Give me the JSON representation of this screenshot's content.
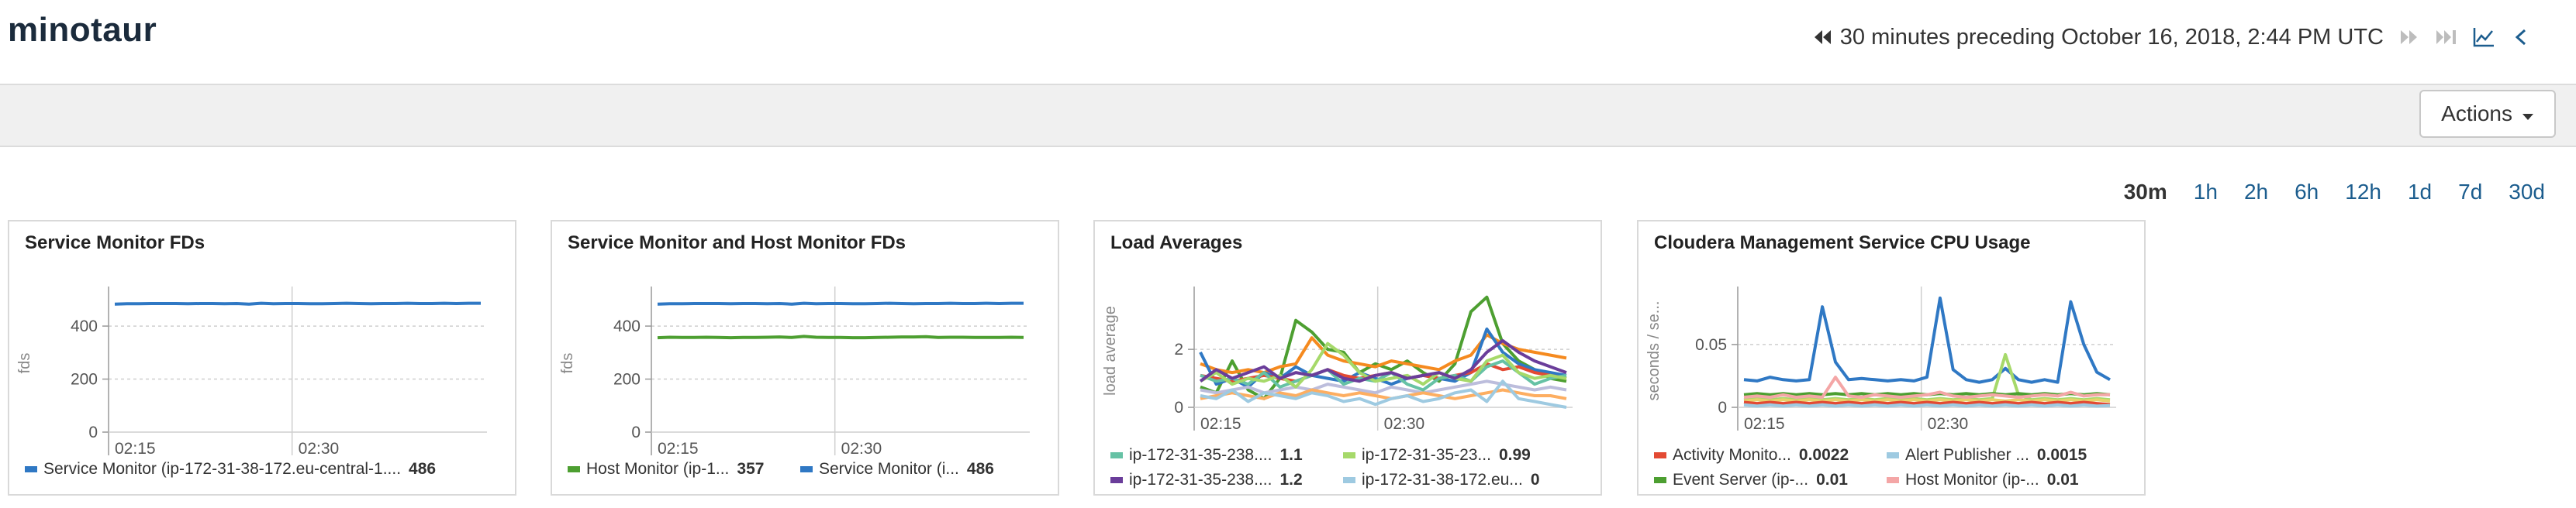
{
  "app": {
    "title": "minotaur"
  },
  "timebar": {
    "label": "30 minutes preceding October 16, 2018, 2:44 PM UTC",
    "icons": [
      "rewind-icon",
      "forward-icon",
      "skip-to-now-icon",
      "chart-icon",
      "collapse-icon"
    ]
  },
  "actions": {
    "label": "Actions",
    "icon": "caret-down-icon"
  },
  "ranges": [
    "30m",
    "1h",
    "2h",
    "6h",
    "12h",
    "1d",
    "7d",
    "30d"
  ],
  "active_range": "30m",
  "chart_data": [
    {
      "title": "Service Monitor FDs",
      "type": "line",
      "ylabel": "fds",
      "x_ticks": [
        "02:15",
        "02:30"
      ],
      "y_ticks": [
        "0",
        "200",
        "400"
      ],
      "ylim": [
        0,
        520
      ],
      "series": [
        {
          "name": "Service Monitor (ip-172-31-38-172.eu-central-1....",
          "color": "#2f78c4",
          "last": "486",
          "values": [
            483,
            484,
            484,
            485,
            485,
            485,
            484,
            485,
            485,
            484,
            485,
            483,
            486,
            484,
            485,
            485,
            484,
            484,
            485,
            486,
            485,
            484,
            485,
            485,
            486,
            485,
            485,
            486,
            485,
            486,
            486
          ]
        }
      ],
      "legend_rows": [
        [
          0
        ]
      ]
    },
    {
      "title": "Service Monitor and Host Monitor FDs",
      "type": "line",
      "ylabel": "fds",
      "x_ticks": [
        "02:15",
        "02:30"
      ],
      "y_ticks": [
        "0",
        "200",
        "400"
      ],
      "ylim": [
        0,
        520
      ],
      "series": [
        {
          "name": "Host Monitor (ip-1...",
          "color": "#4d9f31",
          "last": "357",
          "values": [
            356,
            358,
            357,
            357,
            358,
            357,
            356,
            357,
            357,
            358,
            359,
            357,
            361,
            358,
            357,
            357,
            356,
            356,
            357,
            358,
            359,
            359,
            360,
            357,
            358,
            358,
            357,
            357,
            357,
            358,
            357
          ]
        },
        {
          "name": "Service Monitor (i...",
          "color": "#2f78c4",
          "last": "486",
          "values": [
            483,
            484,
            484,
            485,
            485,
            485,
            484,
            485,
            485,
            484,
            485,
            483,
            486,
            484,
            485,
            485,
            484,
            484,
            485,
            486,
            485,
            484,
            485,
            485,
            486,
            485,
            485,
            486,
            485,
            486,
            486
          ]
        }
      ],
      "legend_rows": [
        [
          0,
          1
        ]
      ]
    },
    {
      "title": "Load Averages",
      "type": "line",
      "ylabel": "load average",
      "x_ticks": [
        "02:15",
        "02:30"
      ],
      "y_ticks": [
        "0",
        "2"
      ],
      "ylim": [
        0,
        3.9
      ],
      "series": [
        {
          "name": "ip-172-31-35-238....",
          "color": "#66c2a5",
          "last": "1.1",
          "values": [
            1.1,
            0.9,
            1.0,
            0.8,
            1.2,
            0.7,
            0.9,
            1.1,
            1.3,
            0.8,
            1.0,
            0.9,
            1.2,
            0.8,
            0.6,
            1.0,
            1.1,
            0.9,
            1.4,
            1.6,
            1.2,
            0.8,
            1.0,
            1.1
          ]
        },
        {
          "name": "ip-172-31-35-23...",
          "color": "#a6d96a",
          "last": "0.99",
          "values": [
            0.9,
            1.2,
            0.8,
            1.0,
            0.9,
            1.1,
            0.7,
            1.3,
            2.2,
            1.8,
            1.2,
            0.9,
            1.0,
            1.1,
            0.8,
            1.2,
            1.0,
            0.9,
            1.6,
            1.8,
            1.2,
            1.0,
            1.1,
            0.99
          ]
        },
        {
          "name": "ip-172-31-35-238....",
          "color": "#6a3d9a",
          "last": "1.2",
          "values": [
            0.9,
            1.3,
            1.0,
            1.2,
            1.4,
            1.0,
            1.2,
            1.1,
            1.3,
            1.0,
            0.9,
            1.1,
            1.2,
            1.0,
            1.1,
            1.2,
            1.0,
            1.3,
            1.9,
            2.3,
            1.9,
            1.6,
            1.4,
            1.2
          ]
        },
        {
          "name": "ip-172-31-38-172.eu...",
          "color": "#9ecae1",
          "last": "0",
          "values": [
            0.4,
            0.3,
            0.6,
            0.2,
            0.5,
            0.4,
            0.3,
            0.5,
            0.4,
            0.2,
            0.3,
            0.1,
            0.3,
            0.4,
            0.2,
            0.3,
            0.5,
            0.6,
            0.2,
            0.9,
            0.3,
            0.2,
            0.1,
            0
          ]
        },
        {
          "name": "",
          "color": "#4d9f31",
          "values": [
            0.7,
            0.5,
            1.6,
            0.6,
            0.3,
            1.0,
            3.0,
            2.6,
            2.0,
            1.9,
            1.2,
            1.5,
            1.3,
            1.6,
            1.2,
            0.9,
            1.5,
            3.3,
            3.8,
            2.2,
            1.6,
            1.3,
            1.0,
            0.9
          ]
        },
        {
          "name": "",
          "color": "#f58a1f",
          "values": [
            1.5,
            1.3,
            1.2,
            1.3,
            1.2,
            1.4,
            1.5,
            2.4,
            1.8,
            1.6,
            1.5,
            1.4,
            1.6,
            1.5,
            1.4,
            1.3,
            1.6,
            1.8,
            2.5,
            2.2,
            2.0,
            1.9,
            1.8,
            1.7
          ]
        },
        {
          "name": "",
          "color": "#2f78c4",
          "values": [
            1.9,
            0.8,
            1.0,
            0.7,
            1.2,
            1.0,
            1.4,
            1.1,
            1.0,
            0.9,
            1.2,
            1.0,
            0.8,
            1.0,
            1.1,
            1.0,
            0.9,
            1.2,
            2.7,
            1.9,
            1.5,
            1.3,
            1.2,
            1.1
          ]
        },
        {
          "name": "",
          "color": "#e34a33",
          "values": [
            1.1,
            1.0,
            0.9,
            1.0,
            1.1,
            1.0,
            0.9,
            1.1,
            1.3,
            1.1,
            1.0,
            1.1,
            1.2,
            1.0,
            1.1,
            1.0,
            1.1,
            1.2,
            1.5,
            1.3,
            1.4,
            1.2,
            1.1,
            1.0
          ]
        },
        {
          "name": "",
          "color": "#bcbddc",
          "values": [
            0.6,
            0.5,
            0.6,
            0.7,
            0.5,
            0.6,
            0.7,
            0.6,
            0.8,
            0.7,
            0.6,
            0.5,
            0.7,
            0.6,
            0.5,
            0.6,
            0.7,
            0.8,
            0.9,
            0.8,
            0.7,
            0.6,
            0.7,
            0.6
          ]
        },
        {
          "name": "",
          "color": "#fdae61",
          "values": [
            0.3,
            0.4,
            0.5,
            0.4,
            0.3,
            0.5,
            0.4,
            0.6,
            0.5,
            0.4,
            0.5,
            0.4,
            0.3,
            0.4,
            0.5,
            0.4,
            0.3,
            0.4,
            0.5,
            0.6,
            0.5,
            0.4,
            0.4,
            0.3
          ]
        }
      ],
      "legend_rows": [
        [
          0,
          1
        ],
        [
          2,
          3
        ]
      ]
    },
    {
      "title": "Cloudera Management Service CPU Usage",
      "type": "line",
      "ylabel": "seconds / se...",
      "x_ticks": [
        "02:15",
        "02:30"
      ],
      "y_ticks": [
        "0",
        "0.05"
      ],
      "ylim": [
        0,
        0.09
      ],
      "series": [
        {
          "name": "Activity Monito...",
          "color": "#e34a33",
          "last": "0.0022",
          "values": [
            0.004,
            0.003,
            0.004,
            0.003,
            0.004,
            0.003,
            0.004,
            0.003,
            0.004,
            0.003,
            0.004,
            0.003,
            0.004,
            0.003,
            0.004,
            0.003,
            0.004,
            0.003,
            0.004,
            0.003,
            0.004,
            0.003,
            0.004,
            0.003,
            0.004,
            0.003,
            0.004,
            0.003,
            0.0022
          ]
        },
        {
          "name": "Alert Publisher ...",
          "color": "#9ecae1",
          "last": "0.0015",
          "values": [
            0.002,
            0.001,
            0.002,
            0.001,
            0.002,
            0.001,
            0.002,
            0.001,
            0.002,
            0.001,
            0.002,
            0.001,
            0.002,
            0.001,
            0.002,
            0.001,
            0.002,
            0.001,
            0.002,
            0.001,
            0.002,
            0.001,
            0.002,
            0.001,
            0.002,
            0.001,
            0.002,
            0.001,
            0.0015
          ]
        },
        {
          "name": "Event Server (ip-...",
          "color": "#4d9f31",
          "last": "0.01",
          "values": [
            0.01,
            0.011,
            0.01,
            0.011,
            0.01,
            0.011,
            0.01,
            0.011,
            0.01,
            0.011,
            0.01,
            0.011,
            0.01,
            0.011,
            0.01,
            0.011,
            0.01,
            0.011,
            0.01,
            0.011,
            0.01,
            0.011,
            0.01,
            0.011,
            0.01,
            0.011,
            0.01,
            0.011,
            0.01
          ]
        },
        {
          "name": "Host Monitor (ip-...",
          "color": "#f4a6a6",
          "last": "0.01",
          "values": [
            0.008,
            0.009,
            0.008,
            0.01,
            0.008,
            0.009,
            0.008,
            0.024,
            0.009,
            0.008,
            0.01,
            0.009,
            0.008,
            0.009,
            0.01,
            0.012,
            0.009,
            0.008,
            0.009,
            0.01,
            0.009,
            0.008,
            0.009,
            0.01,
            0.009,
            0.012,
            0.009,
            0.01,
            0.01
          ]
        },
        {
          "name": "",
          "color": "#2f78c4",
          "values": [
            0.022,
            0.021,
            0.024,
            0.022,
            0.021,
            0.022,
            0.08,
            0.036,
            0.022,
            0.023,
            0.022,
            0.021,
            0.022,
            0.021,
            0.024,
            0.087,
            0.03,
            0.022,
            0.02,
            0.022,
            0.031,
            0.022,
            0.02,
            0.022,
            0.02,
            0.084,
            0.05,
            0.028,
            0.022
          ]
        },
        {
          "name": "",
          "color": "#a6d96a",
          "values": [
            0.006,
            0.007,
            0.006,
            0.007,
            0.006,
            0.007,
            0.006,
            0.007,
            0.006,
            0.007,
            0.006,
            0.007,
            0.006,
            0.007,
            0.006,
            0.007,
            0.006,
            0.007,
            0.006,
            0.007,
            0.042,
            0.01,
            0.006,
            0.007,
            0.006,
            0.007,
            0.006,
            0.007,
            0.006
          ]
        },
        {
          "name": "",
          "color": "#e7d26b",
          "values": [
            0.005,
            0.006,
            0.005,
            0.006,
            0.005,
            0.006,
            0.005,
            0.006,
            0.005,
            0.006,
            0.005,
            0.006,
            0.005,
            0.006,
            0.005,
            0.006,
            0.005,
            0.006,
            0.005,
            0.006,
            0.005,
            0.006,
            0.005,
            0.006,
            0.005,
            0.006,
            0.005,
            0.006,
            0.005
          ]
        }
      ],
      "legend_rows": [
        [
          0,
          1
        ],
        [
          2,
          3
        ]
      ]
    }
  ]
}
